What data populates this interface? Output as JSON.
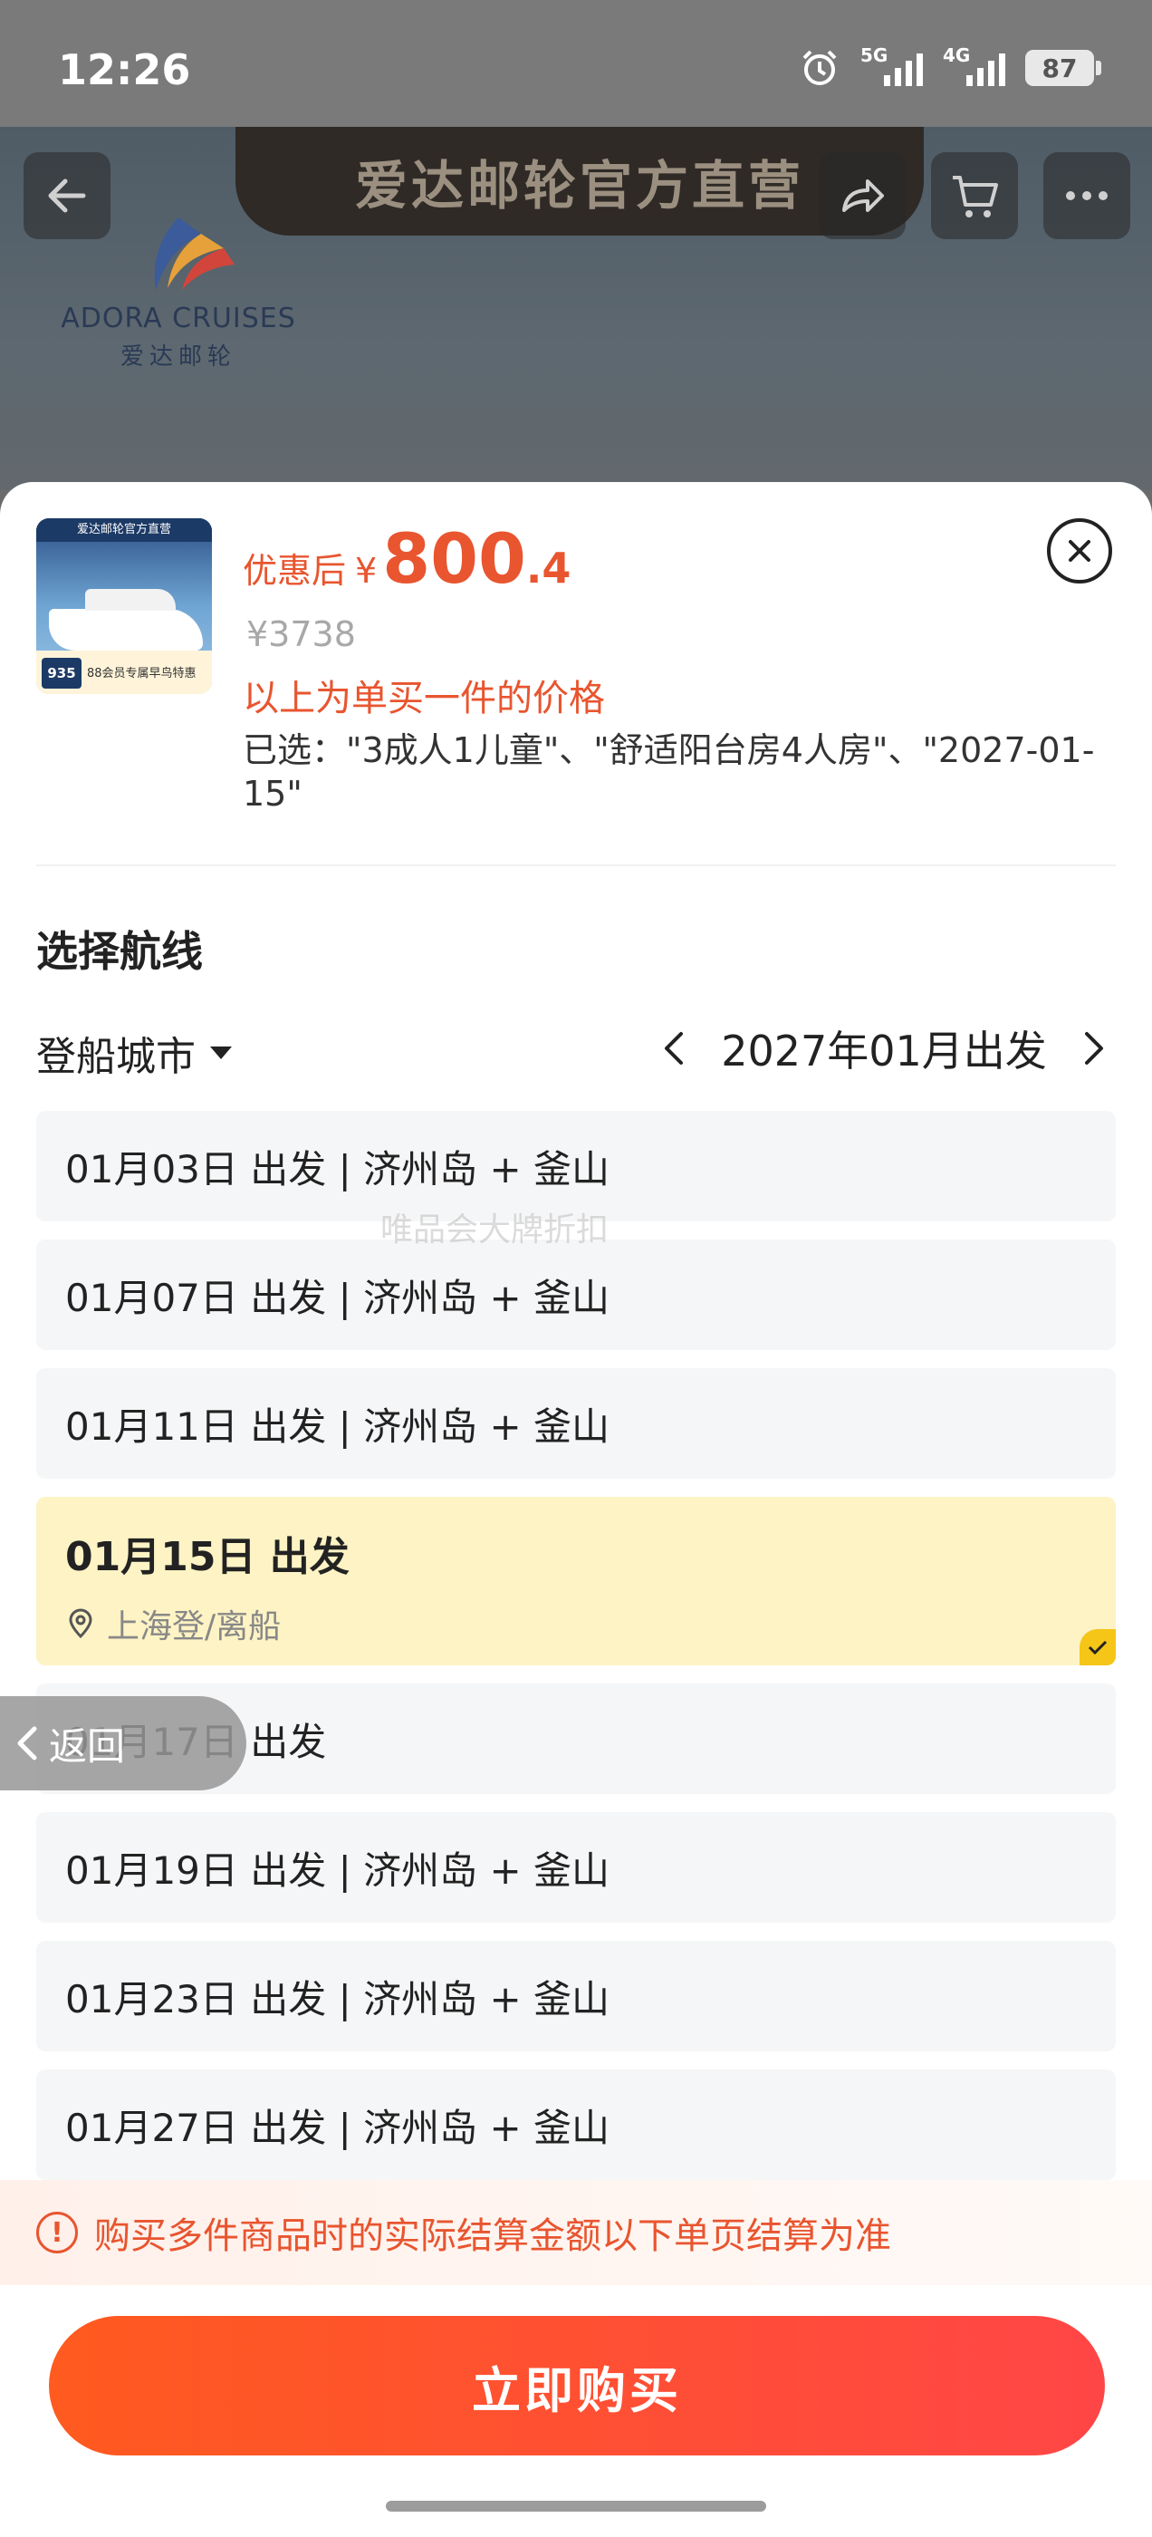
{
  "status_bar": {
    "time": "12:26",
    "signal1": "5G",
    "signal2": "4G",
    "battery": "87"
  },
  "background": {
    "banner_text": "爱达邮轮官方直营",
    "logo_en": "ADORA CRUISES",
    "logo_cn": "爱达邮轮"
  },
  "product": {
    "thumb_title": "爱达邮轮官方直营",
    "thumb_price": "935",
    "thumb_note": "88会员专属早鸟特惠",
    "price_prefix": "优惠后",
    "currency": "¥",
    "price_int": "800",
    "price_dec": ".4",
    "original_price": "¥3738",
    "price_note": "以上为单买一件的价格",
    "selected_text": "已选：\"3成人1儿童\"、\"舒适阳台房4人房\"、\"2027-01-15\""
  },
  "route": {
    "section_title": "选择航线",
    "city_label": "登船城市",
    "month_label": "2027年01月出发",
    "items": [
      {
        "label": "01月03日 出发 | 济州岛 + 釜山"
      },
      {
        "label": "01月07日 出发 | 济州岛 + 釜山"
      },
      {
        "label": "01月11日 出发 | 济州岛 + 釜山"
      },
      {
        "label": "01月15日 出发",
        "port": "上海登/离船"
      },
      {
        "label": "01月17日 出发"
      },
      {
        "label": "01月19日 出发 | 济州岛 + 釜山"
      },
      {
        "label": "01月23日 出发 | 济州岛 + 釜山"
      },
      {
        "label": "01月27日 出发 | 济州岛 + 釜山"
      }
    ],
    "watermark": "唯品会大牌折扣"
  },
  "tip_text": "购买多件商品时的实际结算金额以下单页结算为准",
  "buy_label": "立即购买",
  "back_label": "返回",
  "colors": {
    "accent": "#e8552f",
    "selected_bg": "#fdf3c4",
    "check": "#f5c518"
  }
}
